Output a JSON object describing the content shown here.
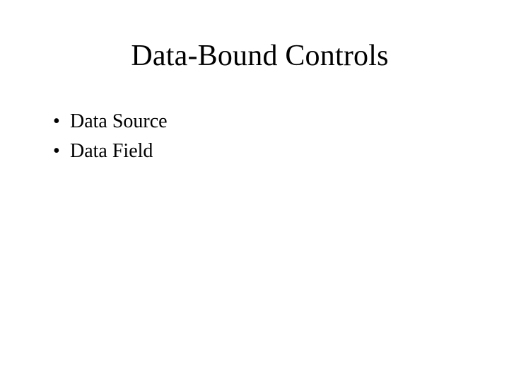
{
  "title": "Data-Bound Controls",
  "bullets": [
    "Data Source",
    "Data Field"
  ]
}
